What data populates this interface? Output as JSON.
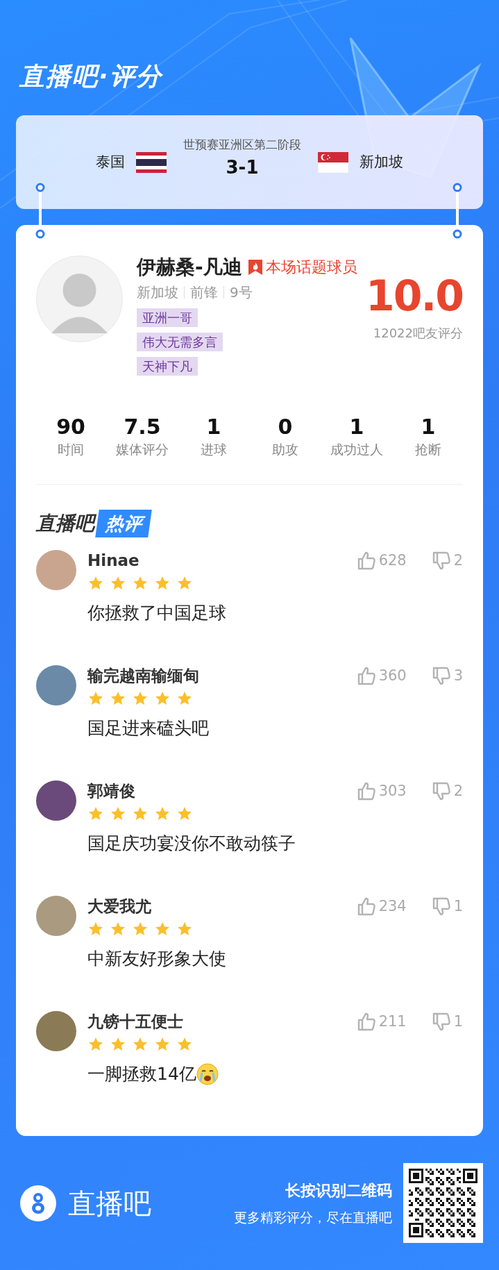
{
  "header": {
    "title": "直播吧·评分"
  },
  "match": {
    "competition": "世预赛亚洲区第二阶段",
    "score": "3-1",
    "teams": [
      {
        "name": "泰国",
        "kind": "thailand"
      },
      {
        "name": "新加坡",
        "kind": "singapore"
      }
    ]
  },
  "player": {
    "name": "伊赫桑-凡迪",
    "badge": "本场话题球员",
    "meta": [
      "新加坡",
      "前锋",
      "9号"
    ],
    "tags": [
      "亚洲一哥",
      "伟大无需多言",
      "天神下凡"
    ],
    "rating": "10.0",
    "rating_count": "12022吧友评分"
  },
  "stats": [
    {
      "value": "90",
      "label": "时间"
    },
    {
      "value": "7.5",
      "label": "媒体评分"
    },
    {
      "value": "1",
      "label": "进球"
    },
    {
      "value": "0",
      "label": "助攻"
    },
    {
      "value": "1",
      "label": "成功过人"
    },
    {
      "value": "1",
      "label": "抢断"
    }
  ],
  "hot_comments": {
    "brand": "直播吧",
    "tag": "热评"
  },
  "comments": [
    {
      "user": "Hinae",
      "stars": 5,
      "likes": "628",
      "dislikes": "2",
      "text": "你拯救了中国足球",
      "trailing_emoji": false
    },
    {
      "user": "输完越南输缅甸",
      "stars": 5,
      "likes": "360",
      "dislikes": "3",
      "text": "国足进来磕头吧",
      "trailing_emoji": false
    },
    {
      "user": "郭靖俊",
      "stars": 5,
      "likes": "303",
      "dislikes": "2",
      "text": "国足庆功宴没你不敢动筷子",
      "trailing_emoji": false
    },
    {
      "user": "大爱我尤",
      "stars": 5,
      "likes": "234",
      "dislikes": "1",
      "text": "中新友好形象大使",
      "trailing_emoji": false
    },
    {
      "user": "九镑十五便士",
      "stars": 5,
      "likes": "211",
      "dislikes": "1",
      "text": "一脚拯救14亿",
      "trailing_emoji": true
    }
  ],
  "footer": {
    "brand": "直播吧",
    "cta": "长按识别二维码",
    "subtitle": "更多精彩评分，尽在直播吧"
  }
}
